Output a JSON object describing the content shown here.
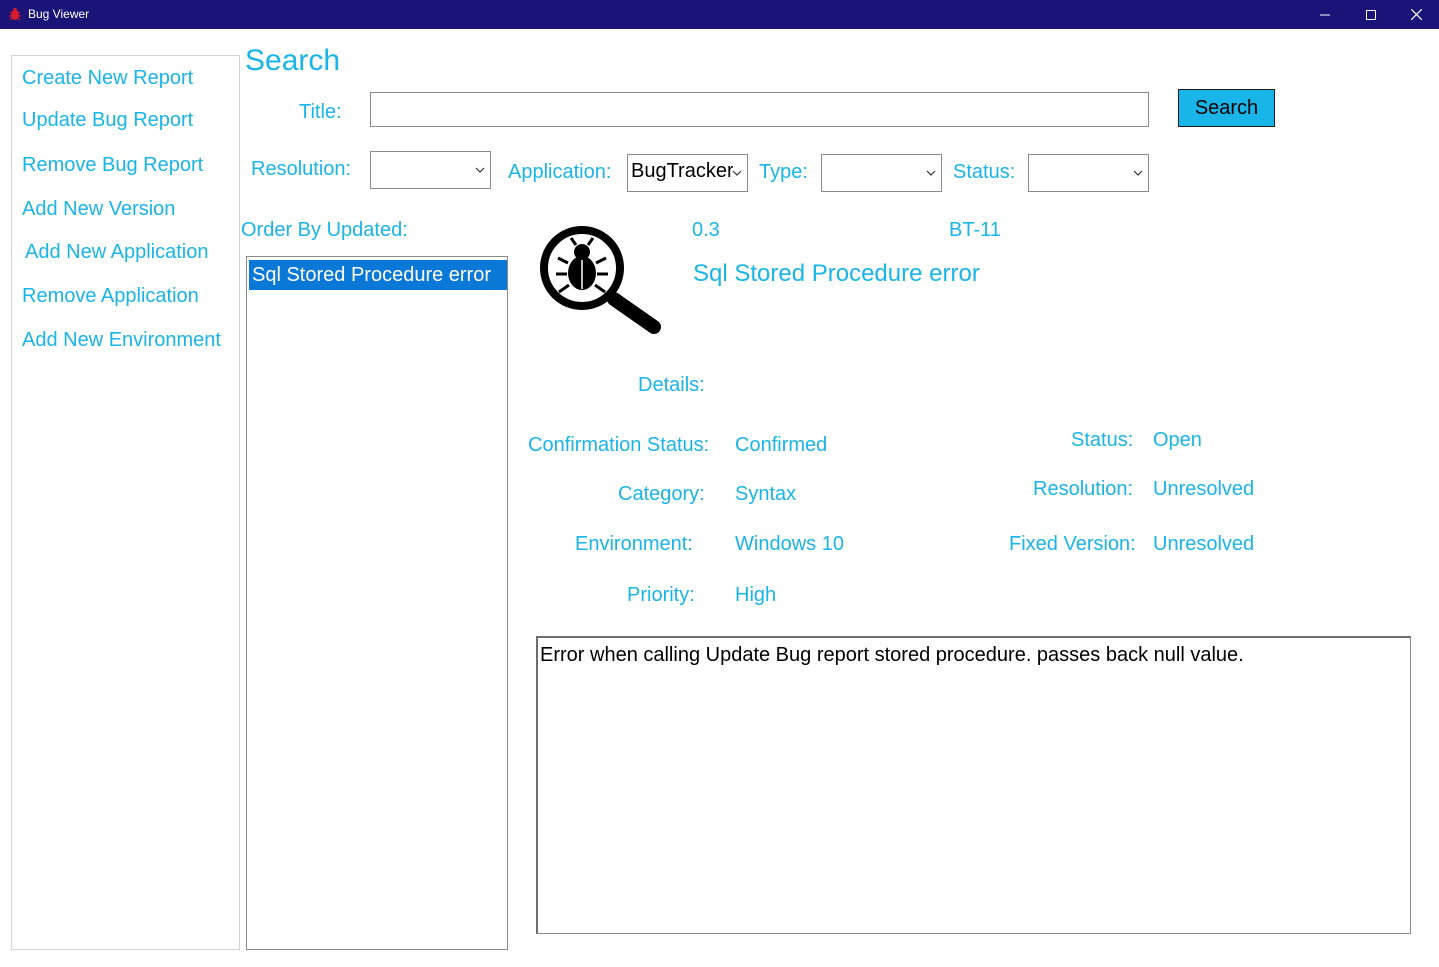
{
  "window": {
    "title": "Bug Viewer",
    "controls": [
      "minimize",
      "maximize",
      "close"
    ]
  },
  "sidebar": {
    "items": [
      {
        "label": "Create New Report"
      },
      {
        "label": "Update Bug Report"
      },
      {
        "label": "Remove Bug Report"
      },
      {
        "label": "Add New Version"
      },
      {
        "label": "Add New Application"
      },
      {
        "label": "Remove Application"
      },
      {
        "label": "Add New Environment"
      }
    ]
  },
  "search": {
    "heading": "Search",
    "title_label": "Title:",
    "title_value": "",
    "search_button": "Search",
    "resolution_label": "Resolution:",
    "resolution_value": "",
    "application_label": "Application:",
    "application_value": "BugTracker",
    "type_label": "Type:",
    "type_value": "",
    "status_label": "Status:",
    "status_value": ""
  },
  "results": {
    "order_label": "Order By Updated:",
    "items": [
      {
        "label": "Sql Stored Procedure error",
        "selected": true
      }
    ]
  },
  "detail": {
    "icon": "bug-search-icon",
    "version": "0.3",
    "id": "BT-11",
    "title": "Sql Stored Procedure error",
    "details_label": "Details:",
    "confirmation_status_label": "Confirmation Status:",
    "confirmation_status": "Confirmed",
    "category_label": "Category:",
    "category": "Syntax",
    "environment_label": "Environment:",
    "environment": "Windows 10",
    "priority_label": "Priority:",
    "priority": "High",
    "status_label": "Status:",
    "status": "Open",
    "resolution_label": "Resolution:",
    "resolution": "Unresolved",
    "fixed_version_label": "Fixed Version:",
    "fixed_version": "Unresolved",
    "description": "Error when calling Update Bug report stored procedure. passes back null value."
  },
  "colors": {
    "titlebar": "#1a1478",
    "accent": "#19b4e8",
    "selection": "#0a78d7",
    "button": "#19b4e8"
  }
}
